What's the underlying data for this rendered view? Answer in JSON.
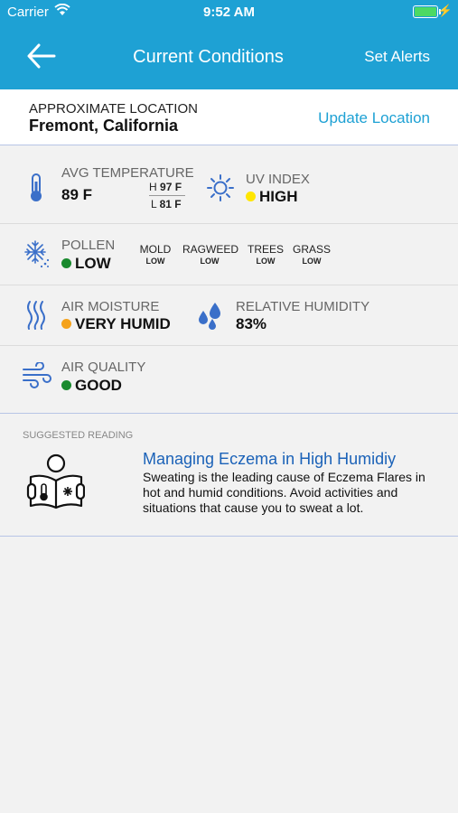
{
  "status_bar": {
    "carrier": "Carrier",
    "time": "9:52 AM"
  },
  "nav": {
    "title": "Current Conditions",
    "action": "Set Alerts"
  },
  "location": {
    "label": "APPROXIMATE LOCATION",
    "value": "Fremont, California",
    "update": "Update Location"
  },
  "temperature": {
    "label": "AVG TEMPERATURE",
    "value": "89 F",
    "high_prefix": "H",
    "high": "97 F",
    "low_prefix": "L",
    "low": "81 F"
  },
  "uv": {
    "label": "UV INDEX",
    "value": "HIGH",
    "color": "#ffe600"
  },
  "pollen": {
    "label": "POLLEN",
    "value": "LOW",
    "color": "#1a8a2e",
    "types": [
      {
        "name": "MOLD",
        "level": "LOW"
      },
      {
        "name": "RAGWEED",
        "level": "LOW"
      },
      {
        "name": "TREES",
        "level": "LOW"
      },
      {
        "name": "GRASS",
        "level": "LOW"
      }
    ]
  },
  "moisture": {
    "label": "AIR MOISTURE",
    "value": "VERY HUMID",
    "color": "#f5a21b"
  },
  "humidity": {
    "label": "RELATIVE HUMIDITY",
    "value": "83%"
  },
  "air_quality": {
    "label": "AIR QUALITY",
    "value": "GOOD",
    "color": "#1a8a2e"
  },
  "reading": {
    "section_label": "SUGGESTED READING",
    "title": "Managing Eczema in High Humidiy",
    "body": "Sweating is the leading cause of Eczema Flares in hot and humid conditions. Avoid activities and situations that cause you to sweat a lot."
  },
  "colors": {
    "header": "#1ea1d4",
    "accent": "#1ea1d4",
    "icon": "#3a6fc9",
    "divider": "#b7c5e6"
  },
  "icons": [
    "back-arrow-icon",
    "wifi-icon",
    "battery-icon",
    "thermometer-icon",
    "sun-icon",
    "pollen-icon",
    "moisture-icon",
    "water-drops-icon",
    "wind-icon",
    "reading-person-icon"
  ]
}
